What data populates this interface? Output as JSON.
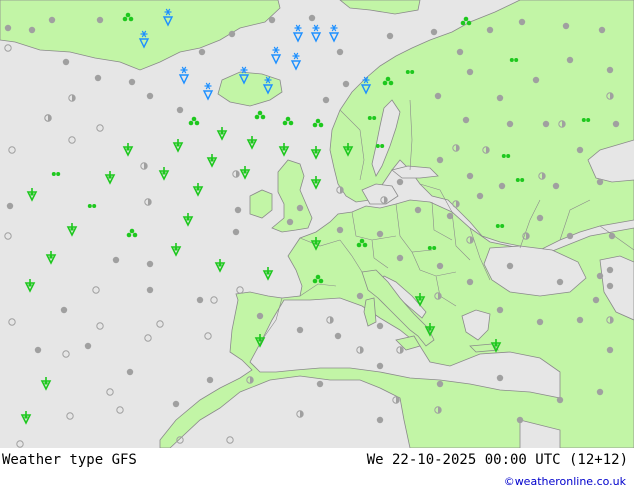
{
  "footer": {
    "left_label": "Weather type  GFS",
    "right_label": "We 22-10-2025 00:00 UTC (12+12)",
    "credit": "©weatheronline.co.uk"
  },
  "colors": {
    "sea": "#e6e6e6",
    "land": "#c2f5a6",
    "rain": "#1ec81e",
    "snow": "#1e90ff",
    "dry": "#a0a0a0"
  },
  "symbol_legend": {
    "rain-shower-icon": "green arrow with drop",
    "snow-icon": "blue snowflake",
    "drizzle-icon": "green double dot",
    "thunderstorm-cloud-icon": "green clover",
    "dry-dot-icon": "grey dot",
    "half-dot-icon": "grey half circle"
  }
}
